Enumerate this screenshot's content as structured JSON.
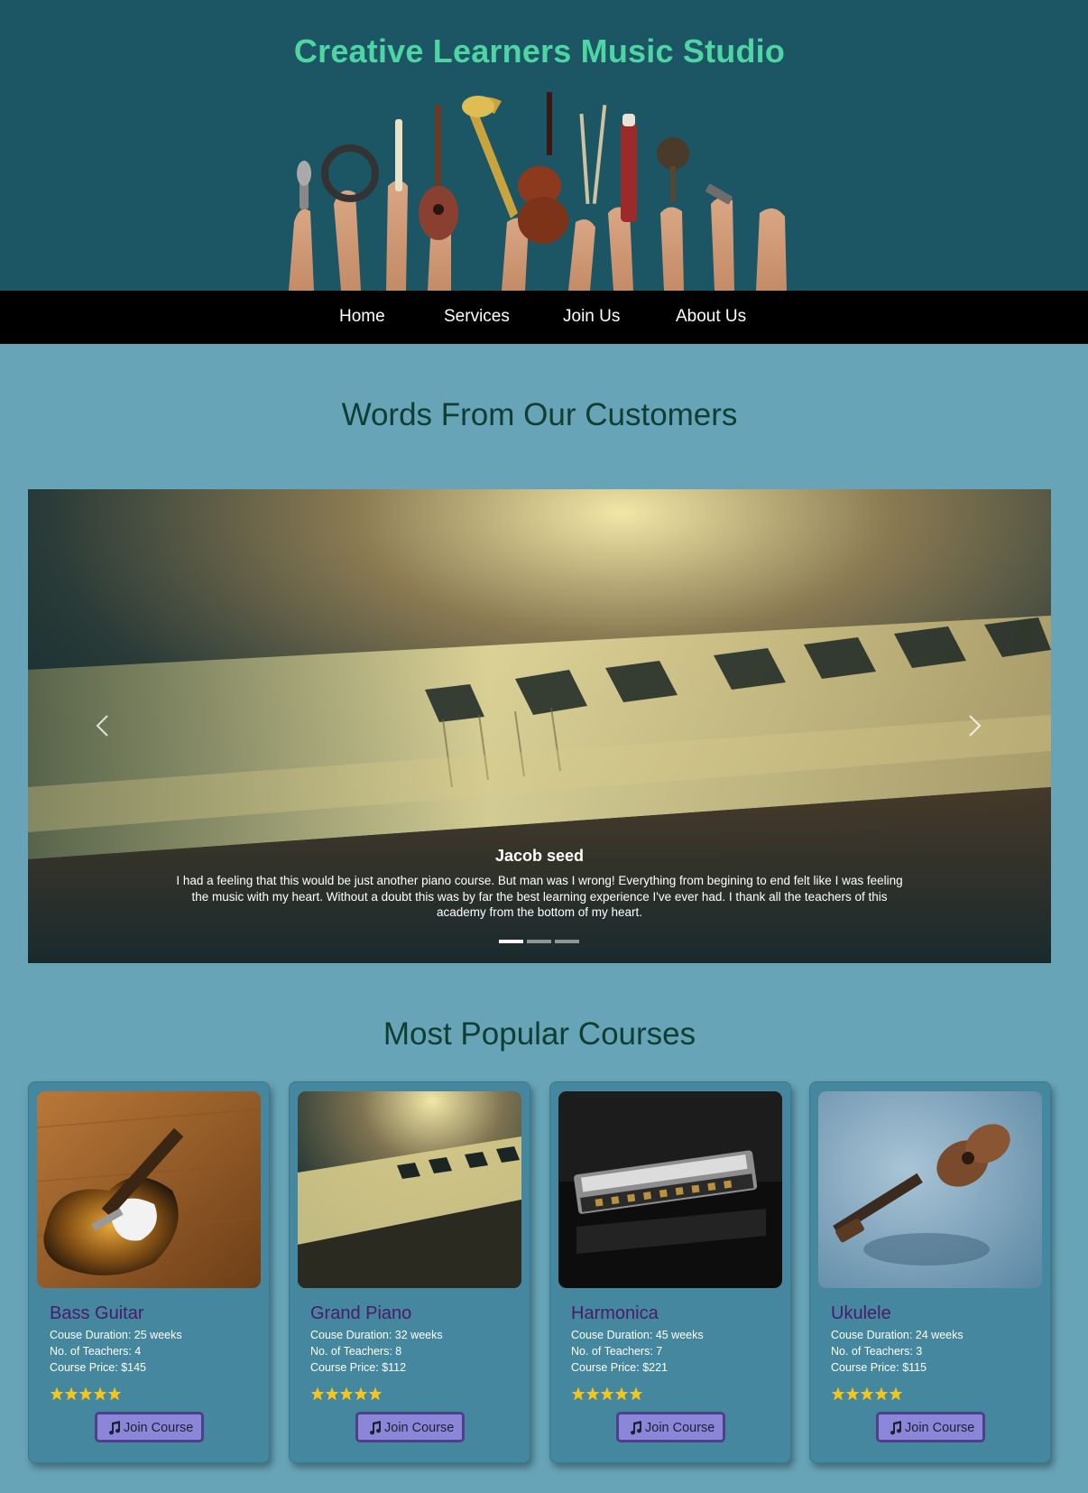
{
  "header": {
    "title": "Creative Learners Music Studio"
  },
  "nav": {
    "items": [
      {
        "label": "Home"
      },
      {
        "label": "Services"
      },
      {
        "label": "Join Us"
      },
      {
        "label": "About Us"
      }
    ]
  },
  "testimonials": {
    "heading": "Words From Our Customers",
    "active_slide": 1,
    "slide_count": 3,
    "caption": {
      "name": "Jacob seed",
      "text": "I had a feeling that this would be just another piano course. But man was I wrong! Everything from begining to end felt like I was feeling the music with my heart. Without a doubt this was by far the best learning experience I've ever had. I thank all the teachers of this academy from the bottom of my heart."
    },
    "prev_icon": "chevron-left-icon",
    "next_icon": "chevron-right-icon"
  },
  "courses": {
    "heading": "Most Popular Courses",
    "items": [
      {
        "title": "Bass Guitar",
        "duration": "Couse Duration: 25 weeks",
        "teachers": "No. of Teachers: 4",
        "price": "Course Price: $145",
        "rating": 5,
        "button": "Join Course",
        "image": "bass-guitar-photo"
      },
      {
        "title": "Grand Piano",
        "duration": "Couse Duration: 32 weeks",
        "teachers": "No. of Teachers: 8",
        "price": "Course Price: $112",
        "rating": 5,
        "button": "Join Course",
        "image": "piano-keys-photo"
      },
      {
        "title": "Harmonica",
        "duration": "Couse Duration: 45 weeks",
        "teachers": "No. of Teachers: 7",
        "price": "Course Price: $221",
        "rating": 5,
        "button": "Join Course",
        "image": "harmonica-photo"
      },
      {
        "title": "Ukulele",
        "duration": "Couse Duration: 24 weeks",
        "teachers": "No. of Teachers: 3",
        "price": "Course Price: $115",
        "rating": 5,
        "button": "Join Course",
        "image": "ukulele-photo"
      }
    ]
  },
  "colors": {
    "header_bg": "#1c5564",
    "title": "#4fd4a3",
    "nav_bg": "#000000",
    "page_bg": "#67a4b7",
    "heading": "#0f3f33",
    "card_bg": "#44879f",
    "card_title": "#4c1a6a",
    "button_bg": "#8b87d8",
    "star": "#f5c518"
  }
}
